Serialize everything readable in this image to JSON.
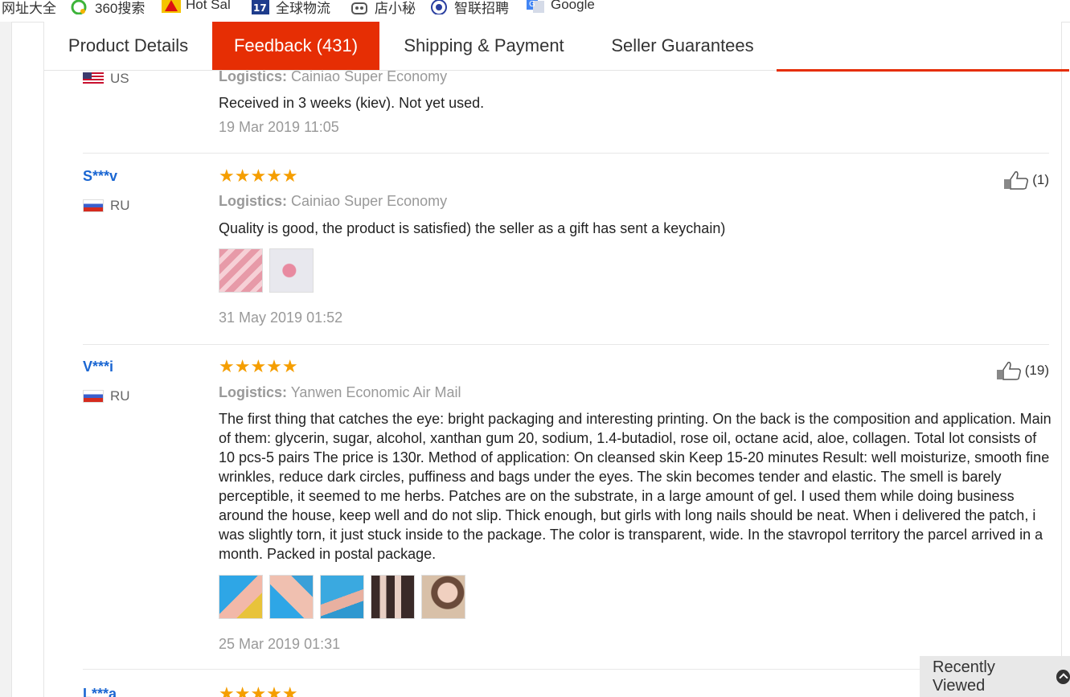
{
  "bookmarks": [
    {
      "label": "网址大全",
      "icon": "none"
    },
    {
      "label": "360搜索",
      "icon": "360-icon"
    },
    {
      "label": "Hot Sal",
      "icon": "hot-sale-icon"
    },
    {
      "label": "全球物流",
      "icon": "17track-icon"
    },
    {
      "label": "店小秘",
      "icon": "dianxiaomi-icon"
    },
    {
      "label": "智联招聘",
      "icon": "zhilian-icon"
    },
    {
      "label": "Google",
      "icon": "google-translate-icon"
    }
  ],
  "tabs": [
    {
      "label": "Product Details"
    },
    {
      "label": "Feedback (431)"
    },
    {
      "label": "Shipping & Payment"
    },
    {
      "label": "Seller Guarantees"
    }
  ],
  "reviews": [
    {
      "country": "US",
      "logistics_label": "Logistics:",
      "logistics": "Cainiao Super Economy",
      "text": "Received in 3 weeks (kiev). Not yet used.",
      "date": "19 Mar 2019 11:05"
    },
    {
      "user": "S***v",
      "country": "RU",
      "stars": "★★★★★",
      "rating": 5,
      "helpful": "(1)",
      "logistics_label": "Logistics:",
      "logistics": "Cainiao Super Economy",
      "text": "Quality is good, the product is satisfied) the seller as a gift has sent a keychain)",
      "date": "31 May 2019 01:52"
    },
    {
      "user": "V***i",
      "country": "RU",
      "stars": "★★★★★",
      "rating": 5,
      "helpful": "(19)",
      "logistics_label": "Logistics:",
      "logistics": "Yanwen Economic Air Mail",
      "text": "The first thing that catches the eye: bright packaging and interesting printing. On the back is the composition and application. Main of them: glycerin, sugar, alcohol, xanthan gum 20, sodium, 1.4-butadiol, rose oil, octane acid, aloe, collagen. Total lot consists of 10 pcs-5 pairs The price is 130r. Method of application: On cleansed skin Keep 15-20 minutes Result: well moisturize, smooth fine wrinkles, reduce dark circles, puffiness and bags under the eyes. The skin becomes tender and elastic. The smell is barely perceptible, it seemed to me herbs. Patches are on the substrate, in a large amount of gel. I used them while doing business around the house, keep well and do not slip. Thick enough, but girls with long nails should be neat. When i delivered the patch, i was slightly torn, it just stuck inside to the package. The color is transparent, wide. In the stavropol territory the parcel arrived in a month. Packed in postal package.",
      "date": "25 Mar 2019 01:31"
    },
    {
      "user": "L***a",
      "stars": "★★★★★"
    }
  ],
  "recently_viewed": "Recently Viewed"
}
